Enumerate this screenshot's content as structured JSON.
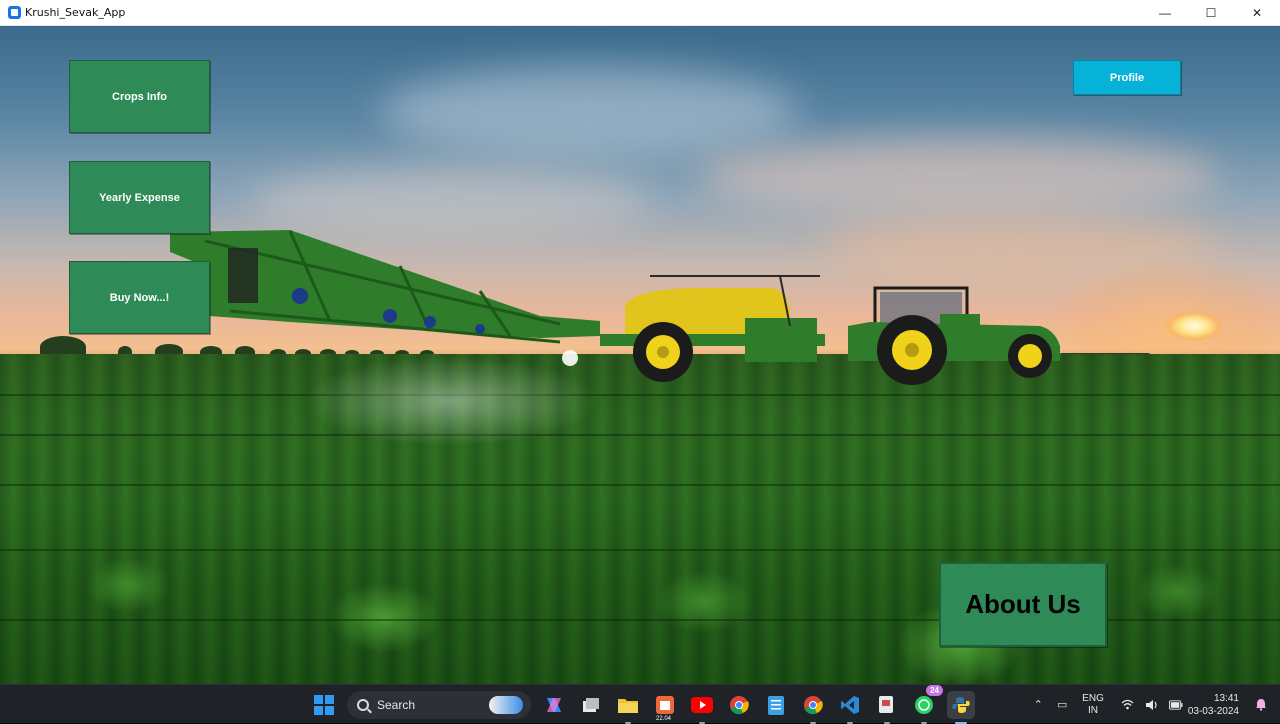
{
  "window": {
    "title": "Krushi_Sevak_App",
    "controls": {
      "minimize": "—",
      "maximize": "☐",
      "close": "✕"
    }
  },
  "buttons": {
    "crops_info": "Crops Info",
    "yearly_expense": "Yearly Expense",
    "buy_now": "Buy Now...!",
    "profile": "Profile",
    "about_us": "About Us"
  },
  "colors": {
    "primary_button": "#2e8b57",
    "profile_button": "#06b2d8",
    "taskbar": "#1f2227"
  },
  "taskbar": {
    "search_placeholder": "Search",
    "apps": [
      "start-icon",
      "search",
      "copilot-icon",
      "task-view-icon",
      "file-explorer-icon",
      "calendar-app-icon",
      "youtube-icon",
      "chrome-icon",
      "notepad-icon",
      "chrome-profile-icon",
      "vscode-icon",
      "snipping-tool-icon",
      "whatsapp-icon",
      "python-app-icon"
    ],
    "whatsapp_badge": "24",
    "calendar_badge": "22.04",
    "language": {
      "line1": "ENG",
      "line2": "IN"
    },
    "time": "13:41",
    "date": "03-03-2024"
  }
}
